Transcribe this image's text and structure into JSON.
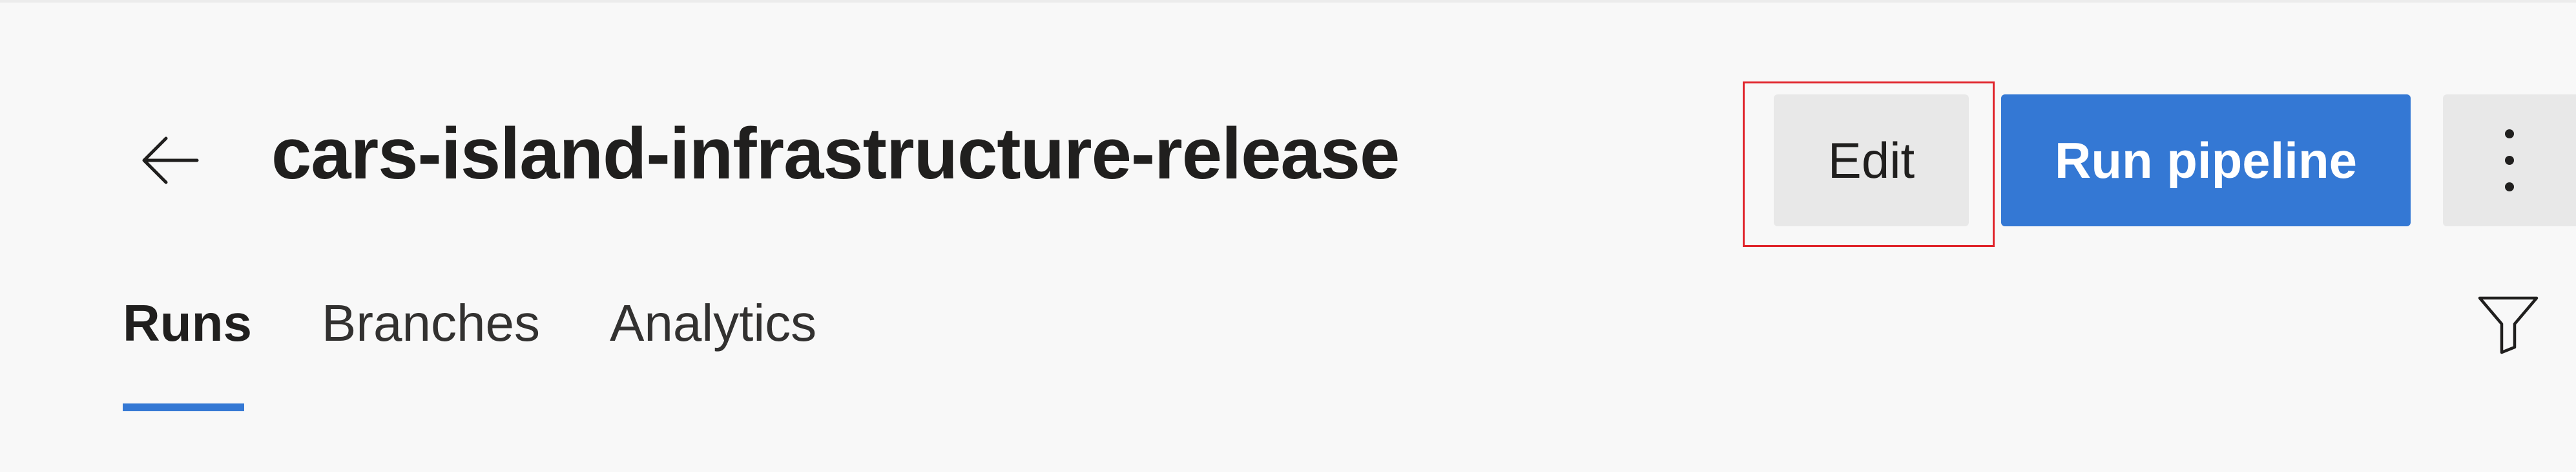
{
  "header": {
    "title": "cars-island-infrastructure-release",
    "back_icon": "arrow-left-icon"
  },
  "toolbar": {
    "edit_label": "Edit",
    "run_label": "Run pipeline",
    "more_icon": "more-vertical-icon",
    "run_color": "#3478d4",
    "highlight_color": "#e0242b"
  },
  "tabs": [
    {
      "label": "Runs",
      "active": true
    },
    {
      "label": "Branches",
      "active": false
    },
    {
      "label": "Analytics",
      "active": false
    }
  ],
  "filter": {
    "icon": "filter-icon"
  }
}
